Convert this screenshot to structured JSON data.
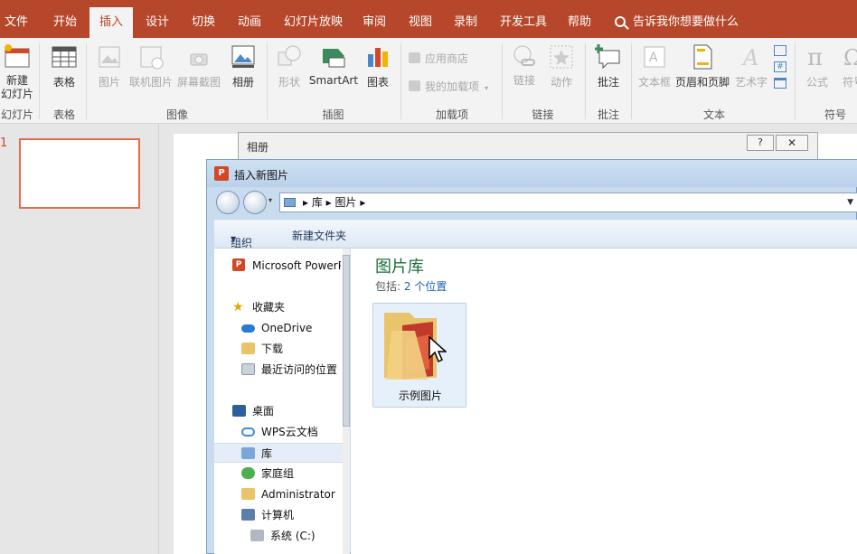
{
  "tabs": [
    "文件",
    "开始",
    "插入",
    "设计",
    "切换",
    "动画",
    "幻灯片放映",
    "审阅",
    "视图",
    "录制",
    "开发工具",
    "帮助"
  ],
  "active_tab": "插入",
  "tell_me": "告诉我你想要做什么",
  "ribbon": {
    "new_slide": "新建\n幻灯片",
    "table": "表格",
    "picture": "图片",
    "online_picture": "联机图片",
    "screenshot": "屏幕截图",
    "album": "相册",
    "shapes": "形状",
    "smartart": "SmartArt",
    "chart": "图表",
    "app_store": "应用商店",
    "my_addins": "我的加载项",
    "link": "链接",
    "action": "动作",
    "comment": "批注",
    "textbox": "文本框",
    "header_footer": "页眉和页脚",
    "wordart": "艺术字",
    "equation": "公式",
    "symbol": "符号",
    "groups": {
      "slides": "幻灯片",
      "tables": "表格",
      "images": "图像",
      "illustrations": "插图",
      "addins": "加载项",
      "links": "链接",
      "comments": "批注",
      "text": "文本",
      "symbols": "符号"
    }
  },
  "slide_number": "1",
  "album_dialog": {
    "title": "相册",
    "help": "?",
    "close": "✕"
  },
  "insert_dialog": {
    "title": "插入新图片",
    "breadcrumb": [
      "库",
      "图片"
    ],
    "organize": "组织",
    "new_folder": "新建文件夹",
    "nav": [
      {
        "label": "Microsoft PowerPoint",
        "icon": "powerpoint-icon"
      },
      {
        "label": "收藏夹",
        "icon": "star-icon"
      },
      {
        "label": "OneDrive",
        "icon": "cloud-icon"
      },
      {
        "label": "下载",
        "icon": "download-folder-icon"
      },
      {
        "label": "最近访问的位置",
        "icon": "recent-places-icon"
      },
      {
        "label": "桌面",
        "icon": "desktop-icon"
      },
      {
        "label": "WPS云文档",
        "icon": "wps-cloud-icon"
      },
      {
        "label": "库",
        "icon": "library-icon"
      },
      {
        "label": "家庭组",
        "icon": "homegroup-icon"
      },
      {
        "label": "Administrator",
        "icon": "user-folder-icon"
      },
      {
        "label": "计算机",
        "icon": "computer-icon"
      },
      {
        "label": "系统 (C:)",
        "icon": "drive-icon"
      }
    ],
    "library_title": "图片库",
    "includes_label": "包括:",
    "includes_link": "2 个位置",
    "folder_name": "示例图片"
  },
  "colors": {
    "accent": "#b7472a",
    "ribbon_bg": "#f3f3f3",
    "dialog_blue": "#c9dcef"
  }
}
